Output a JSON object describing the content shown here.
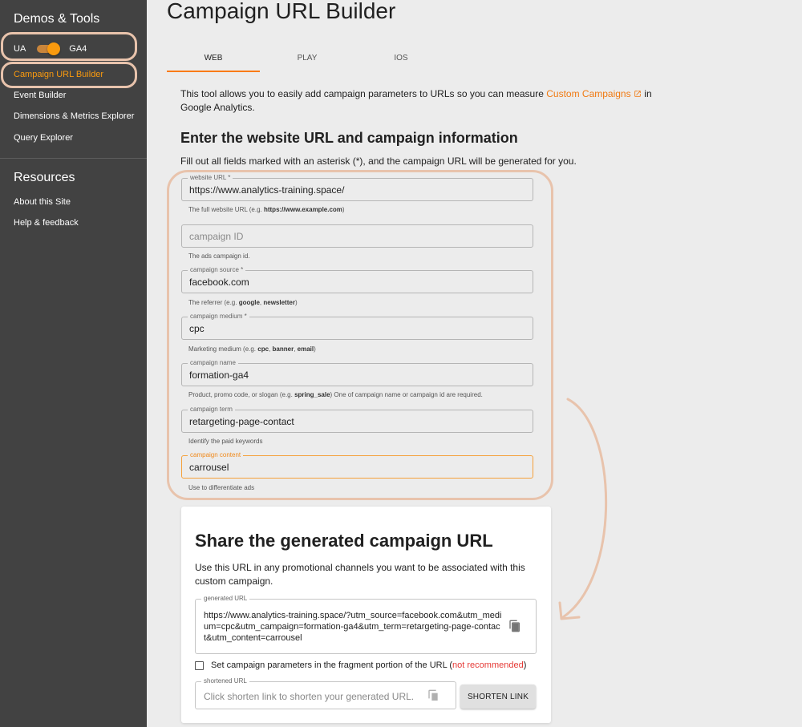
{
  "sidebar": {
    "demos_title": "Demos & Tools",
    "toggle": {
      "left_label": "UA",
      "right_label": "GA4",
      "state": "GA4"
    },
    "items": [
      {
        "label": "Campaign URL Builder",
        "active": true
      },
      {
        "label": "Event Builder"
      },
      {
        "label": "Dimensions & Metrics Explorer"
      },
      {
        "label": "Query Explorer"
      }
    ],
    "resources_title": "Resources",
    "resources": [
      {
        "label": "About this Site"
      },
      {
        "label": "Help & feedback"
      }
    ]
  },
  "page": {
    "title": "Campaign URL Builder",
    "tabs": [
      {
        "label": "WEB",
        "active": true
      },
      {
        "label": "PLAY"
      },
      {
        "label": "IOS"
      }
    ],
    "intro": {
      "before": "This tool allows you to easily add campaign parameters to URLs so you can measure ",
      "link": "Custom Campaigns",
      "after": " in Google Analytics."
    },
    "section_title": "Enter the website URL and campaign information",
    "fill_out": "Fill out all fields marked with an asterisk (*), and the campaign URL will be generated for you."
  },
  "form": {
    "website_url": {
      "label": "website URL *",
      "value": "https://www.analytics-training.space/",
      "help_before": "The full website URL (e.g. ",
      "help_bold": "https://www.example.com",
      "help_after": ")"
    },
    "campaign_id": {
      "placeholder": "campaign ID",
      "value": "",
      "help": "The ads campaign id."
    },
    "campaign_source": {
      "label": "campaign source *",
      "value": "facebook.com",
      "help_before": "The referrer (e.g. ",
      "help_bold1": "google",
      "help_mid": ", ",
      "help_bold2": "newsletter",
      "help_after": ")"
    },
    "campaign_medium": {
      "label": "campaign medium *",
      "value": "cpc",
      "help_before": "Marketing medium (e.g. ",
      "help_bold1": "cpc",
      "help_sep1": ", ",
      "help_bold2": "banner",
      "help_sep2": ", ",
      "help_bold3": "email",
      "help_after": ")"
    },
    "campaign_name": {
      "label": "campaign name",
      "value": "formation-ga4",
      "help_before": "Product, promo code, or slogan (e.g. ",
      "help_bold": "spring_sale",
      "help_after": ") One of campaign name or campaign id are required."
    },
    "campaign_term": {
      "label": "campaign term",
      "value": "retargeting-page-contact",
      "help": "Identify the paid keywords"
    },
    "campaign_content": {
      "label": "campaign content",
      "value": "carrousel",
      "help": "Use to differentiate ads",
      "focused": true
    }
  },
  "share": {
    "title": "Share the generated campaign URL",
    "description": "Use this URL in any promotional channels you want to be associated with this custom campaign.",
    "generated_label": "generated URL",
    "generated_url": "https://www.analytics-training.space/?utm_source=facebook.com&utm_medium=cpc&utm_campaign=formation-ga4&utm_term=retargeting-page-contact&utm_content=carrousel",
    "fragment_label": "Set campaign parameters in the fragment portion of the URL (",
    "fragment_warning": "not recommended",
    "fragment_close": ")",
    "fragment_checked": false,
    "shortened_label": "shortened URL",
    "shortened_placeholder": "Click shorten link to shorten your generated URL.",
    "shorten_button": "SHORTEN LINK"
  },
  "colors": {
    "sidebar_bg": "#424242",
    "accent": "#fa7b17",
    "highlight": "#e8c3ac",
    "warning": "#e53935"
  }
}
